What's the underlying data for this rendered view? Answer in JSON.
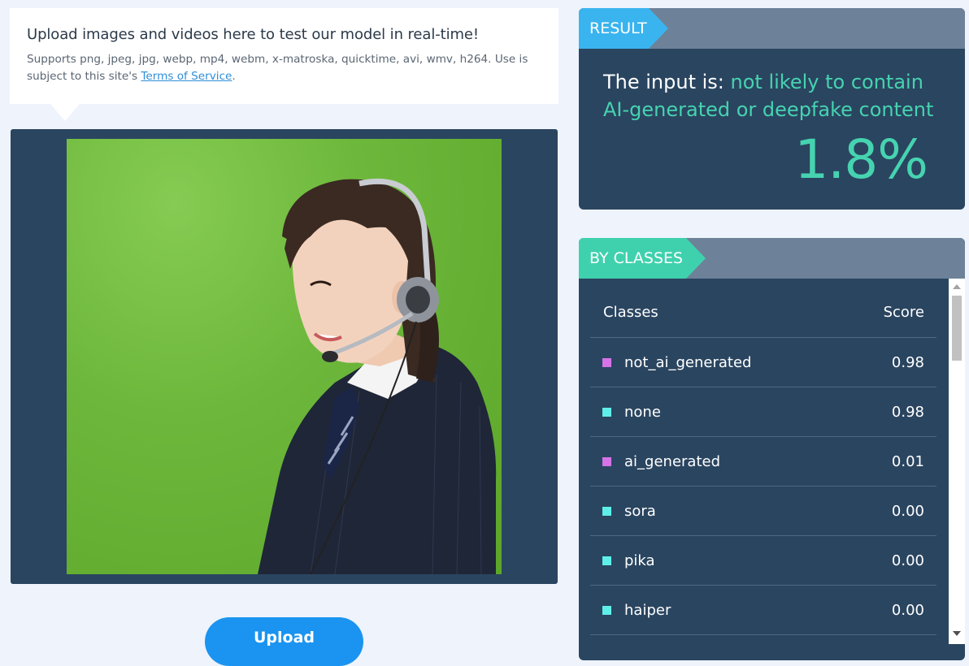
{
  "upload_info": {
    "title": "Upload images and videos here to test our model in real-time!",
    "text_prefix": "Supports png, jpeg, jpg, webp, mp4, webm, x-matroska, quicktime, avi, wmv, h264. Use is subject to this site's ",
    "terms_link": "Terms of Service",
    "text_suffix": "."
  },
  "upload_button": {
    "label": "Upload"
  },
  "result": {
    "tag": "RESULT",
    "prefix": "The input is: ",
    "verdict": "not likely to contain AI-generated or deepfake content",
    "percent": "1.8%",
    "verdict_color": "#46d3b0"
  },
  "by_classes": {
    "tag": "BY CLASSES",
    "header_classes": "Classes",
    "header_score": "Score",
    "rows": [
      {
        "label": "not_ai_generated",
        "score": "0.98",
        "color": "#d673e6"
      },
      {
        "label": "none",
        "score": "0.98",
        "color": "#5ef0e8"
      },
      {
        "label": "ai_generated",
        "score": "0.01",
        "color": "#d673e6"
      },
      {
        "label": "sora",
        "score": "0.00",
        "color": "#5ef0e8"
      },
      {
        "label": "pika",
        "score": "0.00",
        "color": "#5ef0e8"
      },
      {
        "label": "haiper",
        "score": "0.00",
        "color": "#5ef0e8"
      }
    ]
  },
  "colors": {
    "panel": "#2a4560",
    "header": "#6d8299",
    "result_tag": "#3ab4ef",
    "classes_tag": "#3fd1ad",
    "accent": "#46d3b0",
    "button": "#1a94f0"
  },
  "icons": [
    "scroll-up-arrow-icon",
    "scroll-down-arrow-icon"
  ]
}
